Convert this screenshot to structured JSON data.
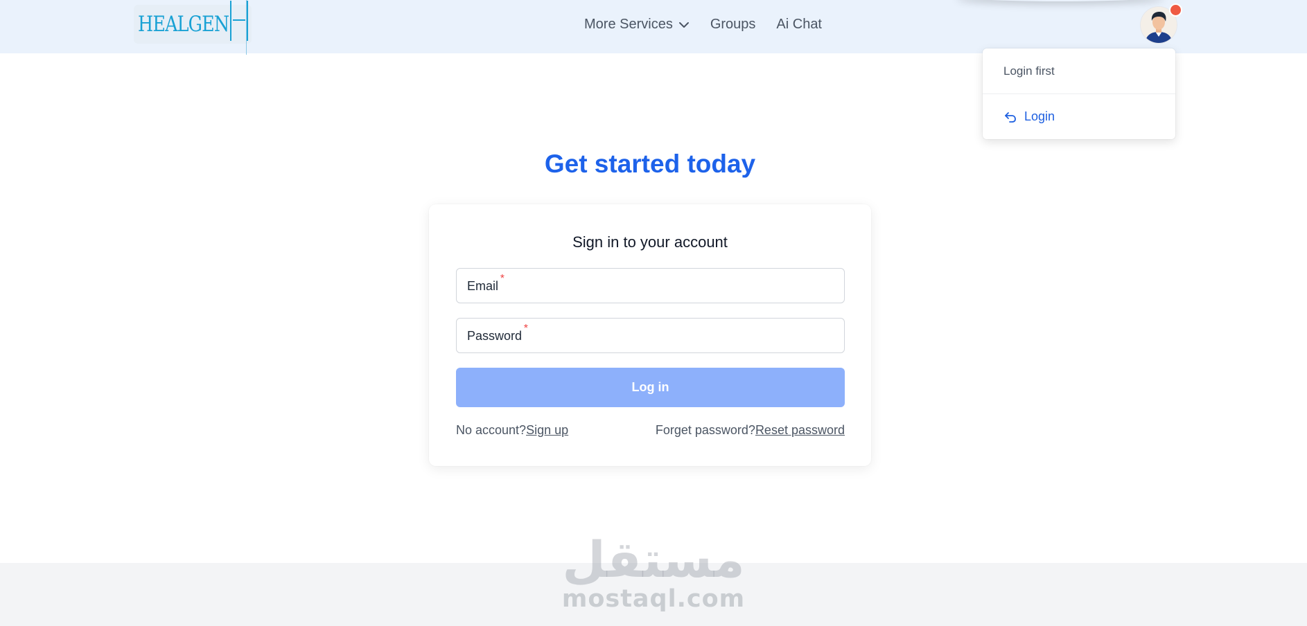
{
  "brand": {
    "logo_text": "HEALGEN"
  },
  "nav": {
    "items": [
      {
        "label": "More Services",
        "has_dropdown": true
      },
      {
        "label": "Groups"
      },
      {
        "label": "Ai Chat"
      }
    ]
  },
  "user_menu": {
    "notification_color": "#ef5a43",
    "login_first": "Login first",
    "login_label": "Login",
    "login_icon": "undo-arrow-icon"
  },
  "hero": {
    "title": "Get started today"
  },
  "signin": {
    "title": "Sign in to your account",
    "email_label": "Email",
    "password_label": "Password",
    "required_mark": "*",
    "login_button": "Log in",
    "no_account_text": "No account?",
    "signup_link": "Sign up",
    "forget_text": "Forget password?",
    "reset_link": "Reset password"
  },
  "watermark": {
    "arabic": "مستقل",
    "latin": "mostaql.com"
  },
  "colors": {
    "accent": "#1d62ea",
    "button_disabled": "#8db0fb",
    "navbar_bg": "#eaf2fc",
    "logo": "#19a1d4"
  }
}
